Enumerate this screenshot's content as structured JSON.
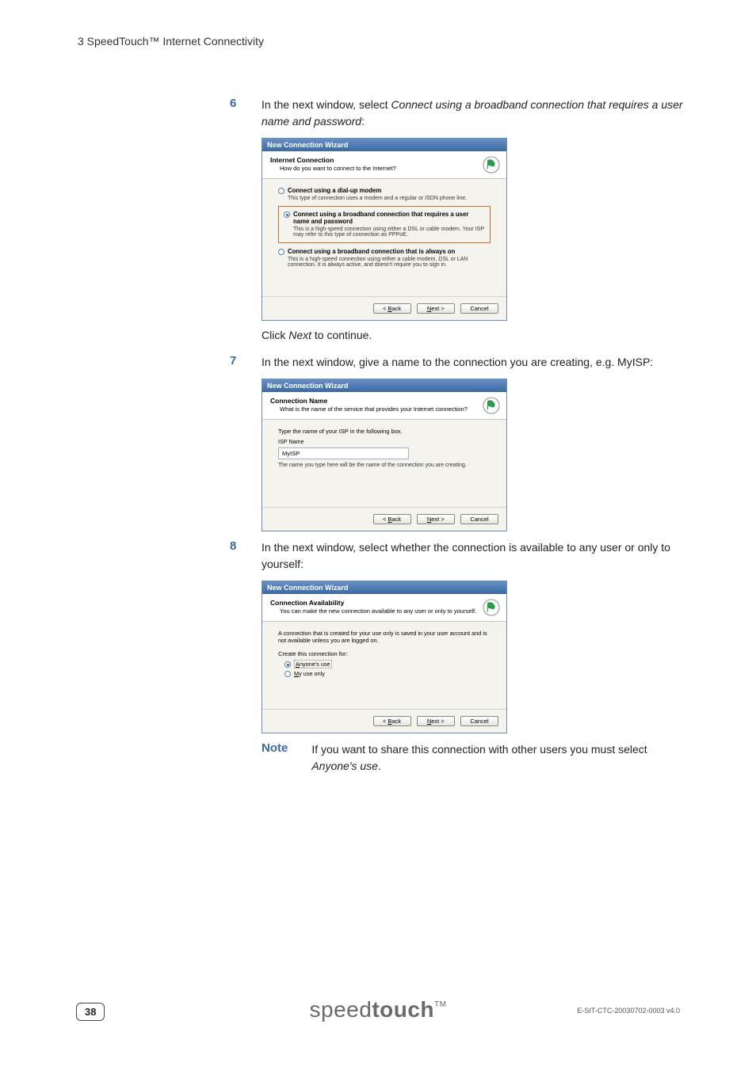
{
  "header": "3   SpeedTouch™ Internet Connectivity",
  "step6": {
    "num": "6",
    "text_pre": "In the next window, select ",
    "text_ital": "Connect using a broadband connection that requires a user name and password",
    "text_post": ":"
  },
  "wizard_title": "New Connection Wizard",
  "wiz1": {
    "head_title": "Internet Connection",
    "head_sub": "How do you want to connect to the Internet?",
    "opt1_label": "Connect using a dial-up modem",
    "opt1_desc": "This type of connection uses a modem and a regular or ISDN phone line.",
    "opt2_label": "Connect using a broadband connection that requires a user name and password",
    "opt2_desc": "This is a high-speed connection using either a DSL or cable modem. Your ISP may refer to this type of connection as PPPoE.",
    "opt3_label": "Connect using a broadband connection that is always on",
    "opt3_desc": "This is a high-speed connection using either a cable modem, DSL or LAN connection. It is always active, and doesn't require you to sign in."
  },
  "click_next_pre": "Click ",
  "click_next_ital": "Next",
  "click_next_post": " to continue.",
  "step7": {
    "num": "7",
    "text": "In the next window, give a name to the connection you are creating, e.g. MyISP:"
  },
  "wiz2": {
    "head_title": "Connection Name",
    "head_sub": "What is the name of the service that provides your Internet connection?",
    "prompt": "Type the name of your ISP in the following box.",
    "isp_label": "ISP Name",
    "isp_value": "MyISP",
    "note": "The name you type here will be the name of the connection you are creating."
  },
  "step8": {
    "num": "8",
    "text": "In the next window, select whether the connection is available to any user or only to yourself:"
  },
  "wiz3": {
    "head_title": "Connection Availability",
    "head_sub": "You can make the new connection available to any user or only to yourself.",
    "note": "A connection that is created for your use only is saved in your user account and is not available unless you are logged on.",
    "create_label": "Create this connection for:",
    "opt_a_pre": "A",
    "opt_a_rest": "nyone's use",
    "opt_b_pre": "M",
    "opt_b_rest": "y use only"
  },
  "buttons": {
    "back_pre": "< ",
    "back_u": "B",
    "back_rest": "ack",
    "next_u": "N",
    "next_rest": "ext >",
    "cancel": "Cancel"
  },
  "note_label": "Note",
  "note_text_pre": "If you want to share this connection with other users you must select ",
  "note_text_ital": "Anyone's use",
  "note_text_post": ".",
  "page_num": "38",
  "brand_thin": "speed",
  "brand_bold": "touch",
  "brand_tm": "TM",
  "doc_id": "E-SIT-CTC-20030702-0003 v4.0",
  "chart_data": {
    "type": "table",
    "description": "No chart present — document page with instructional steps and Windows New Connection Wizard dialog mockups."
  }
}
